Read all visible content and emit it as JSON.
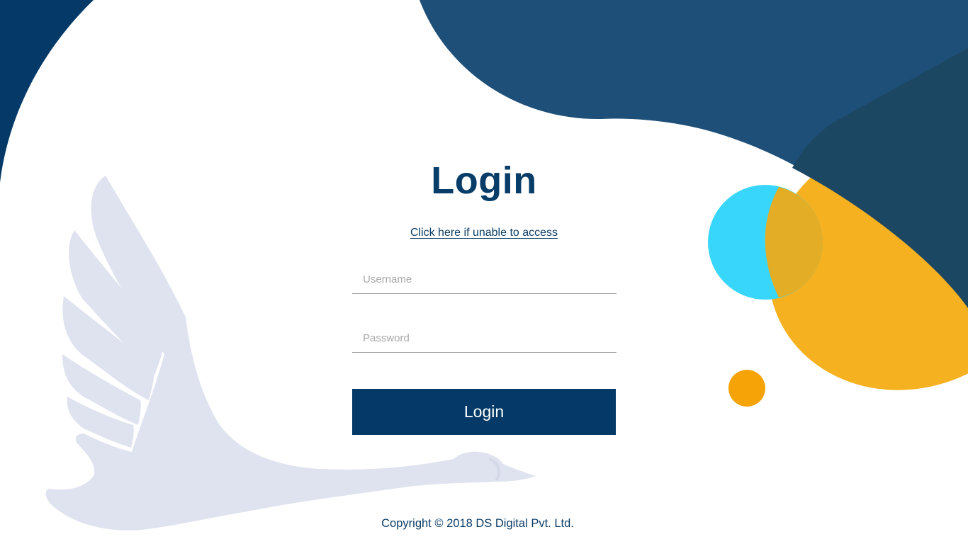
{
  "login": {
    "title": "Login",
    "help_link": "Click here if unable to access",
    "username_placeholder": "Username",
    "password_placeholder": "Password",
    "submit_label": "Login"
  },
  "footer": {
    "copyright": "Copyright © 2018 DS Digital Pvt. Ltd."
  },
  "colors": {
    "primary_navy": "#053a68",
    "blob_blue": "#1e4f78",
    "dark_teal": "#1c4762",
    "cyan": "#38d6fb",
    "yellow": "#f5b120",
    "orange": "#f5a306",
    "swan": "#dfe3ef"
  },
  "icons": {
    "swan": "swan-illustration"
  }
}
